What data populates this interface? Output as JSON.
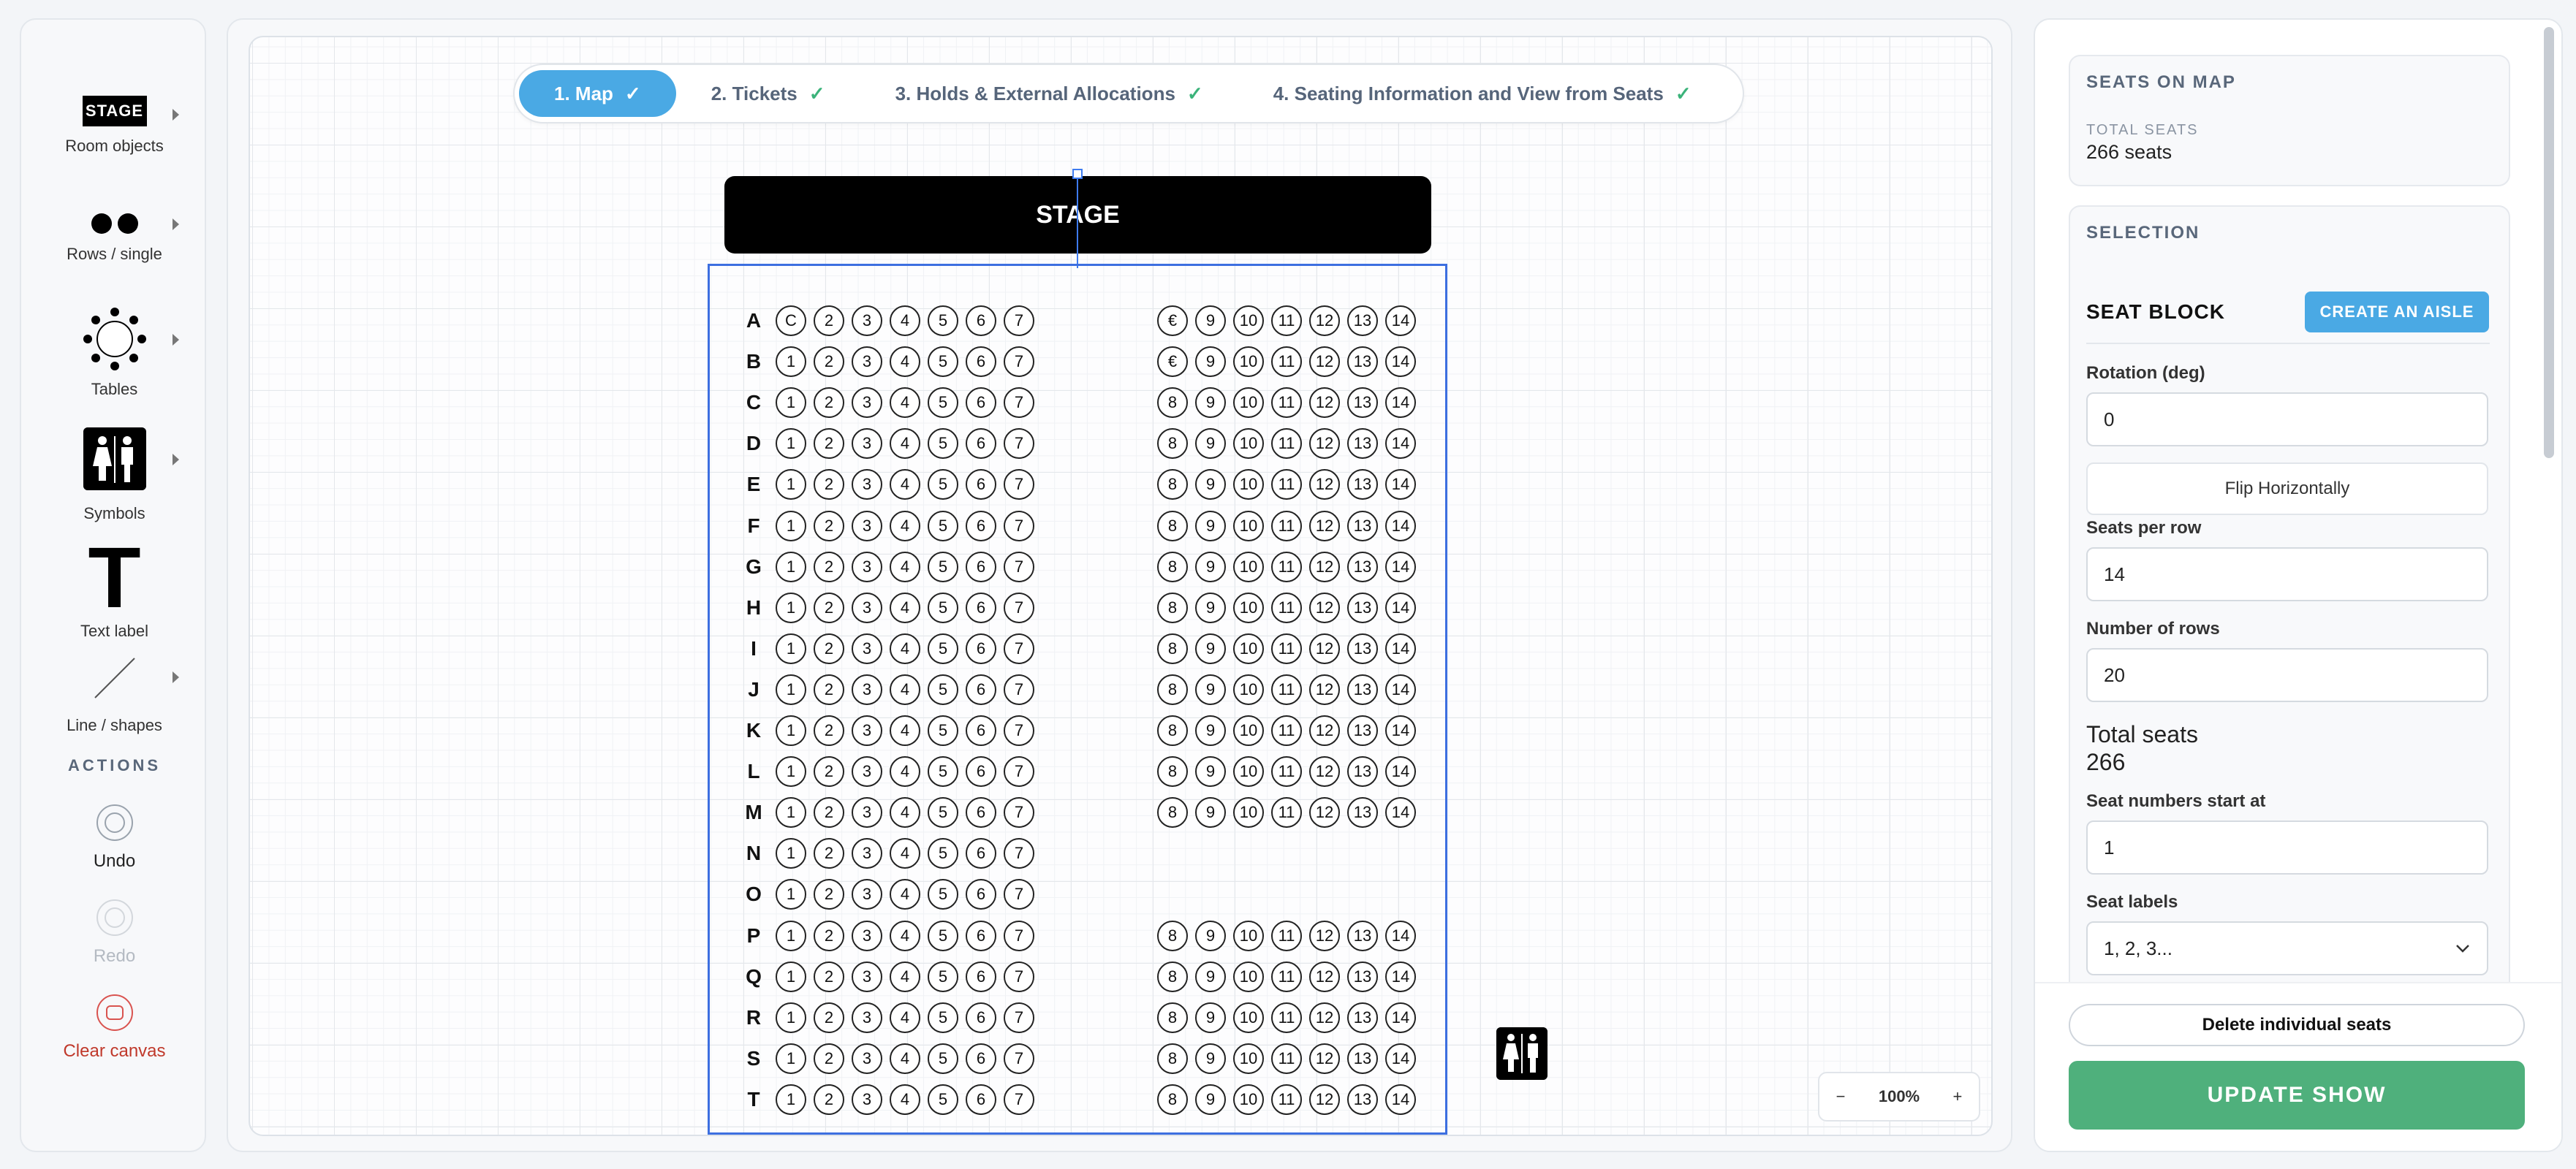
{
  "toolbar": {
    "tools": [
      {
        "label": "Room objects",
        "icon": "stage-icon",
        "icon_text": "STAGE"
      },
      {
        "label": "Rows / single",
        "icon": "dots-icon"
      },
      {
        "label": "Tables",
        "icon": "table-icon"
      },
      {
        "label": "Symbols",
        "icon": "restroom-icon"
      },
      {
        "label": "Text label",
        "icon": "text-icon",
        "icon_text": "T"
      },
      {
        "label": "Line / shapes",
        "icon": "line-icon"
      }
    ],
    "actions_heading": "ACTIONS",
    "actions": [
      {
        "label": "Undo",
        "state": "enabled"
      },
      {
        "label": "Redo",
        "state": "disabled"
      },
      {
        "label": "Clear canvas",
        "state": "danger"
      }
    ]
  },
  "steps": [
    {
      "label": "1. Map",
      "check": "✓",
      "active": true
    },
    {
      "label": "2. Tickets",
      "check": "✓",
      "active": false
    },
    {
      "label": "3. Holds & External Allocations",
      "check": "✓",
      "active": false
    },
    {
      "label": "4. Seating Information and View from Seats",
      "check": "✓",
      "active": false
    }
  ],
  "map": {
    "stage_label": "STAGE",
    "rows": [
      "A",
      "B",
      "C",
      "D",
      "E",
      "F",
      "G",
      "H",
      "I",
      "J",
      "K",
      "L",
      "M",
      "N",
      "O",
      "P",
      "Q",
      "R",
      "S",
      "T"
    ],
    "left_seats": [
      "1",
      "2",
      "3",
      "4",
      "5",
      "6",
      "7"
    ],
    "right_seats": [
      "8",
      "9",
      "10",
      "11",
      "12",
      "13",
      "14"
    ],
    "row_overrides": {
      "A": {
        "left": [
          "C",
          "2",
          "3",
          "4",
          "5",
          "6",
          "7"
        ],
        "right": [
          "€",
          "9",
          "10",
          "11",
          "12",
          "13",
          "14"
        ]
      },
      "B": {
        "right": [
          "€",
          "9",
          "10",
          "11",
          "12",
          "13",
          "14"
        ]
      }
    },
    "rows_without_right_block": [
      "N",
      "O"
    ]
  },
  "zoom": {
    "minus": "−",
    "level": "100%",
    "plus": "+"
  },
  "panel": {
    "seats_on_map_heading": "SEATS ON MAP",
    "total_seats_caption": "TOTAL SEATS",
    "total_seats_value": "266 seats",
    "selection_heading": "SELECTION",
    "seat_block_title": "SEAT BLOCK",
    "create_aisle_label": "CREATE AN AISLE",
    "rotation_label": "Rotation (deg)",
    "rotation_value": "0",
    "flip_label": "Flip Horizontally",
    "seats_per_row_label": "Seats per row",
    "seats_per_row_value": "14",
    "rows_label": "Number of rows",
    "rows_value": "20",
    "total_label": "Total seats",
    "total_value": "266",
    "start_label": "Seat numbers start at",
    "start_value": "1",
    "labels_label": "Seat labels",
    "labels_value": "1, 2, 3...",
    "delete_label": "Delete individual seats",
    "update_label": "UPDATE SHOW"
  }
}
